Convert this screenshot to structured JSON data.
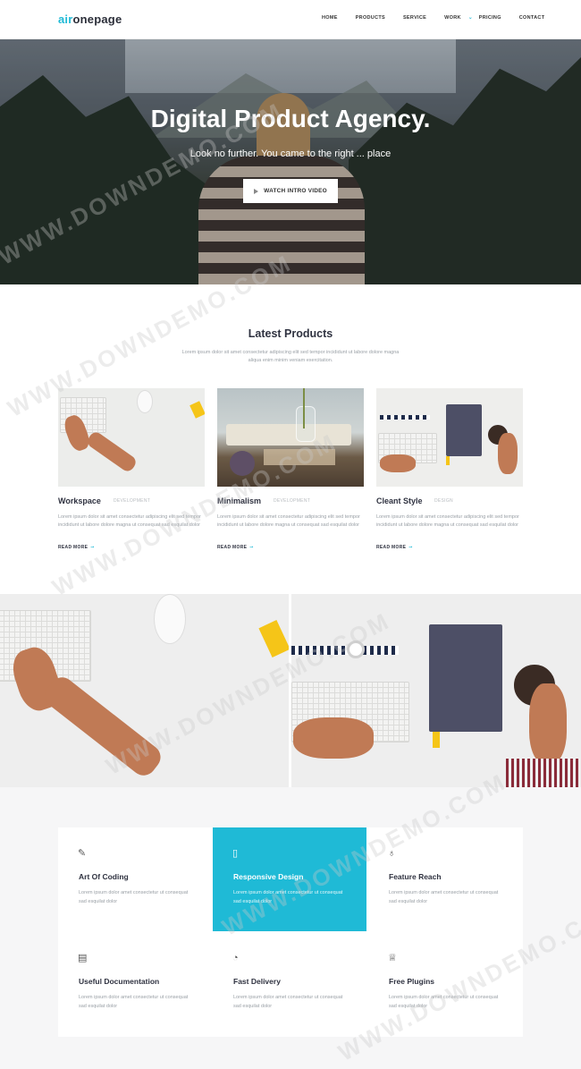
{
  "header": {
    "logo_accent": "air",
    "logo_rest": "onepage",
    "nav": [
      "HOME",
      "PRODUCTS",
      "SERVICE",
      "WORK",
      "PRICING",
      "CONTACT"
    ]
  },
  "hero": {
    "title": "Digital Product Agency.",
    "subtitle": "Look no further. You came to the right ... place",
    "button": "WATCH INTRO VIDEO"
  },
  "products": {
    "title": "Latest Products",
    "description": "Lorem ipsum dolor sit amet consectetur adipiscing elit sed tempor incididunt ut labore dolore magna aliqua enim minim veniam exercitation.",
    "cards": [
      {
        "title": "Workspace",
        "category": "DEVELOPMENT",
        "text": "Lorem ipsum dolor sit amet consectetur adipiscing elit sed tempor incididunt ut labore dolore magna ut consequat sad esquilat dolor",
        "more": "READ MORE"
      },
      {
        "title": "Minimalism",
        "category": "DEVELOPMENT",
        "text": "Lorem ipsum dolor sit amet consectetur adipiscing elit sed tempor incididunt ut labore dolore magna ut consequat sad esquilat dolor",
        "more": "READ MORE"
      },
      {
        "title": "Cleant Style",
        "category": "DESIGN",
        "text": "Lorem ipsum dolor sit amet consectetur adipiscing elit sed tempor incididunt ut labore dolore magna ut consequat sad esquilat dolor",
        "more": "READ MORE"
      }
    ]
  },
  "features": [
    {
      "title": "Art Of Coding",
      "text": "Lorem ipsum dolor amet consectetur ut consequat sad esquilat dolor",
      "icon": "pen-icon"
    },
    {
      "title": "Responsive Design",
      "text": "Lorem ipsum dolor amet consectetur ut consequat sad esquilat dolor",
      "icon": "tablet-icon"
    },
    {
      "title": "Feature Reach",
      "text": "Lorem ipsum dolor amet consectetur ut consequat sad esquilat dolor",
      "icon": "award-icon"
    },
    {
      "title": "Useful Documentation",
      "text": "Lorem ipsum dolor amet consectetur ut consequat sad esquilat dolor",
      "icon": "book-icon"
    },
    {
      "title": "Fast Delivery",
      "text": "Lorem ipsum dolor amet consectetur ut consequat sad esquilat dolor",
      "icon": "speedometer-icon"
    },
    {
      "title": "Free Plugins",
      "text": "Lorem ipsum dolor amet consectetur ut consequat sad esquilat dolor",
      "icon": "ribbon-icon"
    }
  ],
  "watermark": "WWW.DOWNDEMO.COM",
  "colors": {
    "accent": "#1fbad6",
    "dark": "#2f3240",
    "muted": "#9aa0a6"
  }
}
